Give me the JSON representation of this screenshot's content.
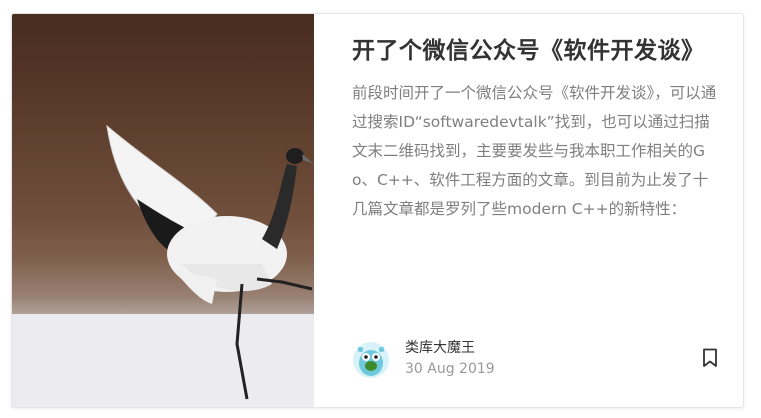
{
  "post": {
    "title": "开了个微信公众号《软件开发谈》",
    "excerpt": "前段时间开了一个微信公众号《软件开发谈》，可以通过搜索ID“softwaredevtalk”找到，也可以通过扫描文末二维码找到，主要要发些与我本职工作相关的Go、C++、软件工程方面的文章。到目前为止发了十几篇文章都是罗列了些modern C++的新特性：",
    "author": "类库大魔王",
    "date": "30 Aug 2019",
    "image_icon": "red-crowned-crane-photo",
    "avatar_icon": "gopher-avatar-icon",
    "bookmark_icon": "bookmark-icon"
  }
}
